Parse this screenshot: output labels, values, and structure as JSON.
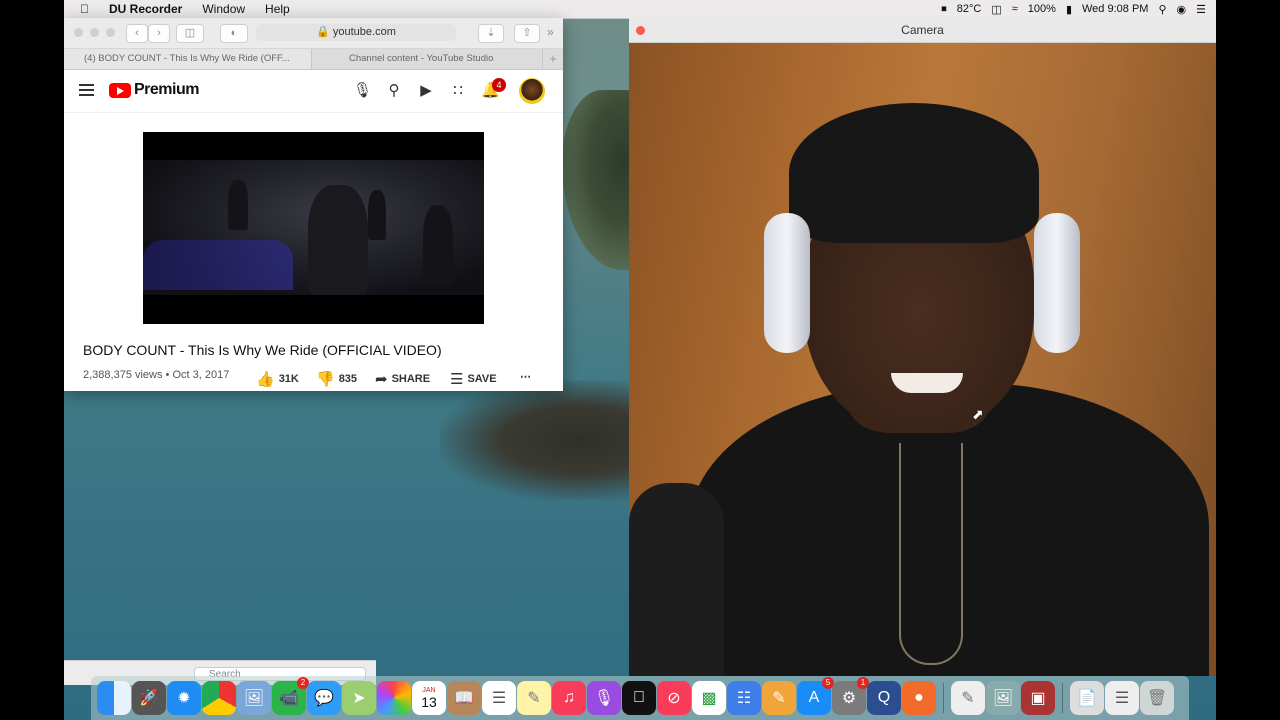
{
  "menubar": {
    "app_name": "DU Recorder",
    "items": [
      "Window",
      "Help"
    ],
    "temperature": "82°C",
    "battery": "100%",
    "clock": "Wed 9:08 PM"
  },
  "browser": {
    "url": "youtube.com",
    "tabs": [
      {
        "label": "(4) BODY COUNT - This Is Why We Ride (OFF..."
      },
      {
        "label": "Channel content - YouTube Studio"
      }
    ],
    "new_tab": "+",
    "youtube": {
      "logo": "Premium",
      "notification_count": "4",
      "video_title": "BODY COUNT - This Is Why We Ride (OFFICIAL VIDEO)",
      "views_date": "2,388,375 views • Oct 3, 2017",
      "likes": "31K",
      "dislikes": "835",
      "share_label": "SHARE",
      "save_label": "SAVE"
    }
  },
  "camera": {
    "title": "Camera"
  },
  "finder": {
    "search_placeholder": "Search"
  },
  "dock": {
    "apps": [
      "Finder",
      "Launchpad",
      "Safari",
      "Chrome",
      "Preview",
      "FaceTime",
      "Messages",
      "Maps",
      "Photos",
      "Calendar",
      "Contacts",
      "Reminders",
      "Notes",
      "Music",
      "Podcasts",
      "TV",
      "News",
      "Numbers",
      "Keynote",
      "Pages",
      "App Store",
      "System Preferences",
      "QuickTime",
      "DU Recorder",
      "TextEdit",
      "Preview",
      "Photo Booth",
      "Documents",
      "Downloads",
      "Trash"
    ],
    "badges": {
      "FaceTime": "2",
      "App Store": "5",
      "System Preferences": "1"
    },
    "calendar_day": "13",
    "calendar_month": "JAN"
  },
  "colors": {
    "youtube_red": "#ff0000",
    "close_red": "#fc5753"
  }
}
